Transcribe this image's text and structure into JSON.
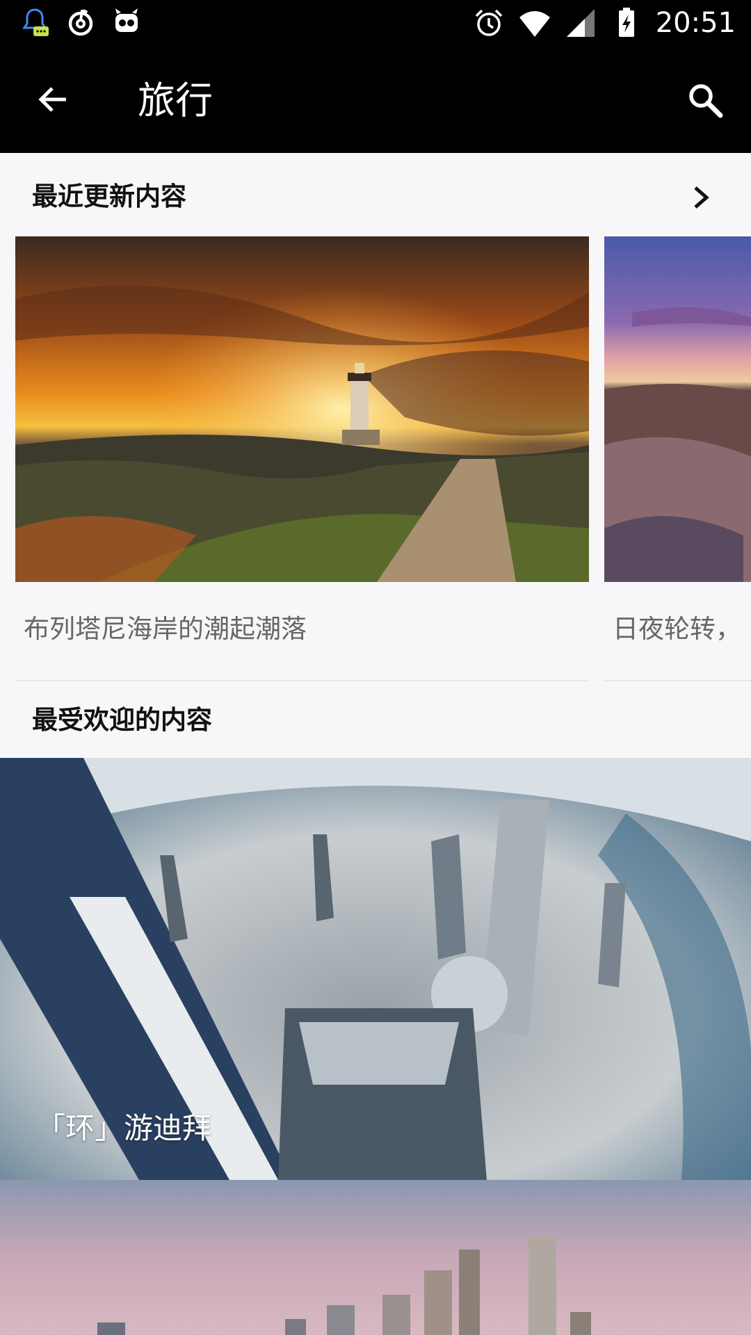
{
  "status_bar": {
    "time": "20:51",
    "left_icons": [
      "qq-notification-icon",
      "netease-music-icon",
      "robot-app-icon"
    ],
    "right_icons": [
      "alarm-icon",
      "wifi-icon",
      "cell-signal-icon",
      "battery-charging-icon"
    ]
  },
  "app_bar": {
    "title": "旅行",
    "back_icon": "arrow-back-icon",
    "search_icon": "search-icon"
  },
  "recent": {
    "title": "最近更新内容",
    "more_icon": "chevron-right-icon",
    "cards": [
      {
        "caption": "布列塔尼海岸的潮起潮落"
      },
      {
        "caption": "日夜轮转，"
      }
    ]
  },
  "popular": {
    "title": "最受欢迎的内容",
    "items": [
      {
        "label": "「环」游迪拜"
      },
      {
        "label": ""
      }
    ]
  },
  "colors": {
    "bar_bg": "#000000",
    "page_bg": "#f7f7f9",
    "caption_text": "#666666",
    "section_title": "#111111"
  }
}
